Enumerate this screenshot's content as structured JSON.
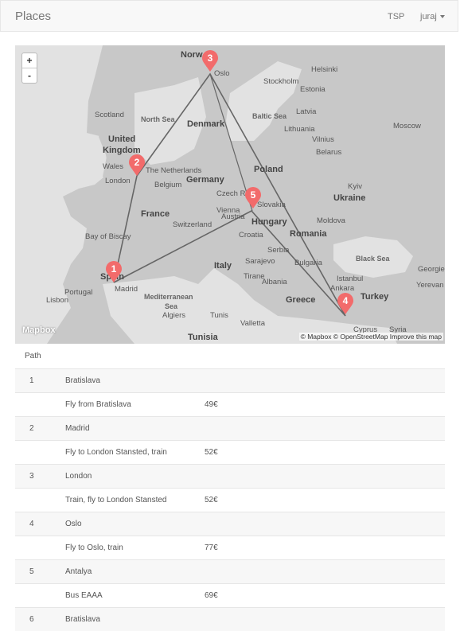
{
  "navbar": {
    "brand": "Places",
    "tsp_label": "TSP",
    "user_label": "juraj"
  },
  "map": {
    "zoom_in": "+",
    "zoom_out": "-",
    "logo": "Mapbox",
    "attribution": "© Mapbox © OpenStreetMap Improve this map",
    "labels": {
      "norway": "Norw",
      "oslo": "Oslo",
      "helsinki": "Helsinki",
      "stockholm": "Stockholm",
      "estonia": "Estonia",
      "scotland": "Scotland",
      "north_sea": "North Sea",
      "denmark": "Denmark",
      "baltic_sea": "Baltic Sea",
      "latvia": "Latvia",
      "lithuania": "Lithuania",
      "moscow": "Moscow",
      "vilnius": "Vilnius",
      "united": "United",
      "kingdom": "Kingdom",
      "belarus": "Belarus",
      "wales": "Wales",
      "netherlands": "The Netherlands",
      "london": "London",
      "belgium": "Belgium",
      "germany": "Germany",
      "poland": "Poland",
      "kyiv": "Kyiv",
      "ukraine": "Ukraine",
      "czech": "Czech Rep",
      "slovakia": "Slovakia",
      "france": "France",
      "vienna": "Vienna",
      "austria": "Austria",
      "hungary": "Hungary",
      "moldova": "Moldova",
      "switzerland": "Switzerland",
      "bay_of_biscay": "Bay of Biscay",
      "croatia": "Croatia",
      "romania": "Romania",
      "serbia": "Serbia",
      "black_sea": "Black Sea",
      "italy": "Italy",
      "sarajevo": "Sarajevo",
      "bulgaria": "Bulgaria",
      "georgia": "Georgie",
      "spain": "Spain",
      "madrid": "Madrid",
      "portugal": "Portugal",
      "lisbon": "Lisbon",
      "tirane": "Tirane",
      "albania": "Albania",
      "istanbul": "Istanbul",
      "yerevan": "Yerevan",
      "mediterranean": "Mediterranean",
      "sea": "Sea",
      "greece": "Greece",
      "ankara": "Ankara",
      "turkey": "Turkey",
      "algiers": "Algiers",
      "tunis": "Tunis",
      "valletta": "Valletta",
      "cyprus": "Cyprus",
      "syria": "Syria",
      "tunisia": "Tunisia"
    },
    "markers": [
      {
        "num": "1",
        "place": "Madrid"
      },
      {
        "num": "2",
        "place": "London"
      },
      {
        "num": "3",
        "place": "Oslo"
      },
      {
        "num": "4",
        "place": "Antalya"
      },
      {
        "num": "5",
        "place": "Bratislava"
      }
    ]
  },
  "table": {
    "header": "Path",
    "rows": [
      {
        "index": "1",
        "place": "Bratislava"
      },
      {
        "desc": "Fly from Bratislava",
        "price": "49€"
      },
      {
        "index": "2",
        "place": "Madrid"
      },
      {
        "desc": "Fly to London Stansted, train",
        "price": "52€"
      },
      {
        "index": "3",
        "place": "London"
      },
      {
        "desc": "Train, fly to London Stansted",
        "price": "52€"
      },
      {
        "index": "4",
        "place": "Oslo"
      },
      {
        "desc": "Fly to Oslo, train",
        "price": "77€"
      },
      {
        "index": "5",
        "place": "Antalya"
      },
      {
        "desc": "Bus EAAA",
        "price": "69€"
      },
      {
        "index": "6",
        "place": "Bratislava"
      }
    ]
  },
  "colors": {
    "marker": "#f26b6b",
    "route": "#666666",
    "land": "#c8c8c8",
    "water": "#e2e2e2"
  }
}
